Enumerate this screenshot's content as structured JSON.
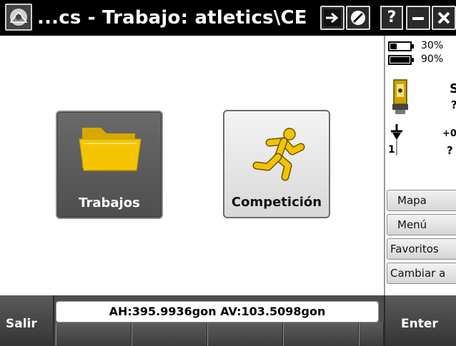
{
  "titlebar": {
    "title": "...cs - Trabajo: atletics\\CE",
    "help_label": "?",
    "app_icon": "app-menu-icon",
    "forward_icon": "forward-arrow-icon",
    "settings_icon": "circle-slash-icon",
    "minimize_icon": "minimize-icon",
    "close_icon": "close-icon"
  },
  "main": {
    "tiles": [
      {
        "label": "Trabajos",
        "icon": "folder-icon"
      },
      {
        "label": "Competición",
        "icon": "running-man-icon"
      }
    ]
  },
  "status_panel": {
    "battery1": {
      "value": "30%",
      "icon": "battery-icon"
    },
    "battery2": {
      "value": "90%",
      "icon": "battery-icon"
    },
    "instrument": {
      "line1": "S",
      "line2": "?",
      "icon": "total-station-icon"
    },
    "gnss": {
      "line1": "+0",
      "line2": "?",
      "number": "1",
      "icon": "target-icon"
    },
    "buttons": [
      "Mapa",
      "Menú",
      "Favoritos",
      "Cambiar a"
    ]
  },
  "bottom": {
    "left_button": "Salir",
    "right_button": "Enter",
    "angle_readout": "AH:395.9936gon  AV:103.5098gon"
  },
  "colors": {
    "titlebar_bg": "#000000",
    "folder_yellow": "#f5c400",
    "runner_yellow": "#f2c300",
    "tile_dark": "#5a5a5a",
    "softkey_bar": "#4d4d4d"
  }
}
